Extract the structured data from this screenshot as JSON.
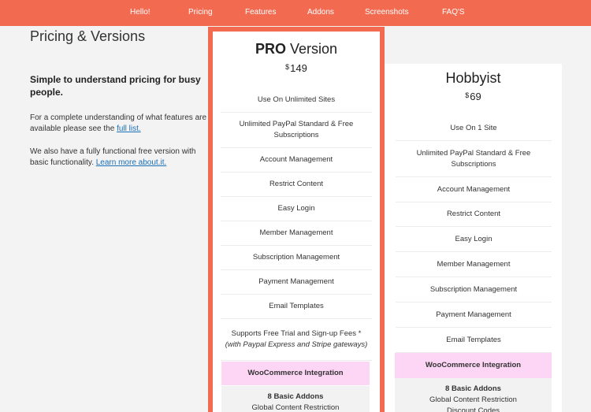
{
  "nav": [
    "Hello!",
    "Pricing",
    "Features",
    "Addons",
    "Screenshots",
    "FAQ'S"
  ],
  "page_title": "Pricing & Versions",
  "lead": "Simple to understand pricing for busy people.",
  "para1": {
    "text": "For a complete understanding of what features are available please see the ",
    "link": "full list."
  },
  "para2": {
    "text": "We also have a fully functional free version with basic functionality. ",
    "link": "Learn more about.it."
  },
  "pro": {
    "title_bold": "PRO",
    "title_rest": " Version",
    "currency": "$",
    "price": "149",
    "features": [
      "Use On Unlimited Sites",
      "Unlimited PayPal Standard & Free Subscriptions",
      "Account Management",
      "Restrict Content",
      "Easy Login",
      "Member Management",
      "Subscription Management",
      "Payment Management",
      "Email Templates"
    ],
    "trial": "Supports Free Trial and Sign-up Fees *",
    "trial_note": "(with Paypal Express and Stripe gateways)",
    "woo": "WooCommerce Integration",
    "addons_title": "8 Basic Addons",
    "addons_items": [
      "Global Content Restriction"
    ]
  },
  "hobbyist": {
    "title": "Hobbyist",
    "currency": "$",
    "price": "69",
    "features": [
      "Use On 1 Site",
      "Unlimited PayPal Standard & Free Subscriptions",
      "Account Management",
      "Restrict Content",
      "Easy Login",
      "Member Management",
      "Subscription Management",
      "Payment Management",
      "Email Templates"
    ],
    "woo": "WooCommerce Integration",
    "addons_title": "8 Basic Addons",
    "addons_items": [
      "Global Content Restriction",
      "Discount Codes"
    ]
  },
  "colors": {
    "accent": "#f26a50",
    "highlight": "#fdd5f5",
    "link": "#1a6fb5"
  }
}
